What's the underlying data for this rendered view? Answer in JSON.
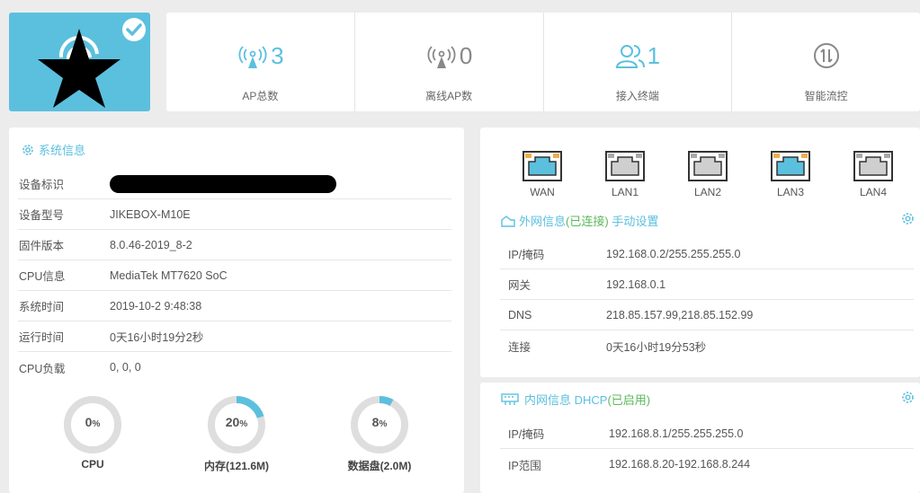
{
  "stats": [
    {
      "icon": "ap-signal-icon",
      "value": "3",
      "label": "AP总数"
    },
    {
      "icon": "ap-offline-icon",
      "value": "0",
      "label": "离线AP数"
    },
    {
      "icon": "users-icon",
      "value": "1",
      "label": "接入终端"
    },
    {
      "icon": "traffic-control-icon",
      "value": "",
      "label": "智能流控"
    }
  ],
  "system": {
    "title": "系统信息",
    "rows": [
      {
        "key": "设备标识",
        "value": ""
      },
      {
        "key": "设备型号",
        "value": "JIKEBOX-M10E"
      },
      {
        "key": "固件版本",
        "value": "8.0.46-2019_8-2"
      },
      {
        "key": "CPU信息",
        "value": "MediaTek MT7620 SoC"
      },
      {
        "key": "系统时间",
        "value": "2019-10-2 9:48:38"
      },
      {
        "key": "运行时间",
        "value": "0天16小时19分2秒"
      },
      {
        "key": "CPU负载",
        "value": "0, 0, 0"
      }
    ],
    "gauges": [
      {
        "value": "0",
        "unit": "%",
        "percent": 0,
        "label": "CPU"
      },
      {
        "value": "20",
        "unit": "%",
        "percent": 20,
        "label": "内存(121.6M)"
      },
      {
        "value": "8",
        "unit": "%",
        "percent": 8,
        "label": "数据盘(2.0M)"
      }
    ]
  },
  "ports": [
    {
      "label": "WAN",
      "active": true
    },
    {
      "label": "LAN1",
      "active": false
    },
    {
      "label": "LAN2",
      "active": false
    },
    {
      "label": "LAN3",
      "active": true
    },
    {
      "label": "LAN4",
      "active": false
    }
  ],
  "wan": {
    "title": "外网信息",
    "status": "(已连接)",
    "mode": "手动设置",
    "rows": [
      {
        "key": "IP/掩码",
        "value": "192.168.0.2/255.255.255.0"
      },
      {
        "key": "网关",
        "value": "192.168.0.1"
      },
      {
        "key": "DNS",
        "value": "218.85.157.99,218.85.152.99"
      },
      {
        "key": "连接",
        "value": "0天16小时19分53秒"
      }
    ]
  },
  "lan": {
    "title": "内网信息 DHCP",
    "status": "(已启用)",
    "rows": [
      {
        "key": "IP/掩码",
        "value": "192.168.8.1/255.255.255.0"
      },
      {
        "key": "IP范围",
        "value": "192.168.8.20-192.168.8.244"
      }
    ]
  },
  "colors": {
    "accent": "#5bc0de",
    "green": "#5cb85c",
    "port_active": "#f0ad4e"
  }
}
